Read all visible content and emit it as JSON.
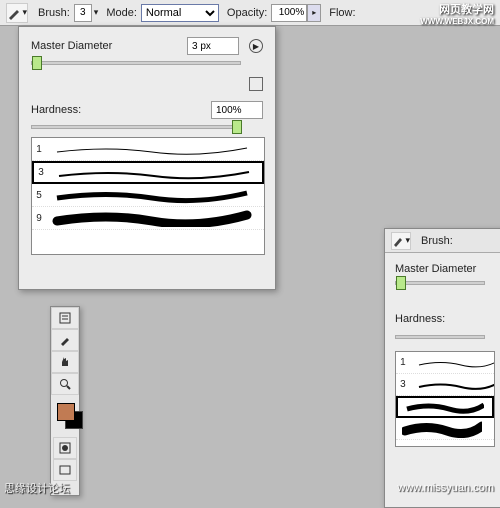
{
  "options": {
    "brush_label": "Brush:",
    "brush_size": "3",
    "mode_label": "Mode:",
    "mode_value": "Normal",
    "opacity_label": "Opacity:",
    "opacity_value": "100%",
    "flow_label": "Flow:"
  },
  "brush_panel": {
    "master_diameter_label": "Master Diameter",
    "master_diameter_value": "3 px",
    "hardness_label": "Hardness:",
    "hardness_value": "100%",
    "brushes": [
      {
        "size": "1",
        "selected": false
      },
      {
        "size": "3",
        "selected": true
      },
      {
        "size": "5",
        "selected": false
      },
      {
        "size": "9",
        "selected": false
      }
    ]
  },
  "panel2": {
    "brush_label": "Brush:",
    "master_diameter_label": "Master Diameter",
    "hardness_label": "Hardness:",
    "brushes": [
      {
        "size": "1"
      },
      {
        "size": "3"
      }
    ]
  },
  "toolbox": {
    "fg_color": "#c17b53",
    "bg_color": "#000000"
  },
  "watermarks": {
    "top_right_cn": "网页教学网",
    "top_right_url": "WWW.WEBJX.COM",
    "bottom_right": "www.missyuan.com",
    "bottom_left": "思缘设计论坛"
  }
}
